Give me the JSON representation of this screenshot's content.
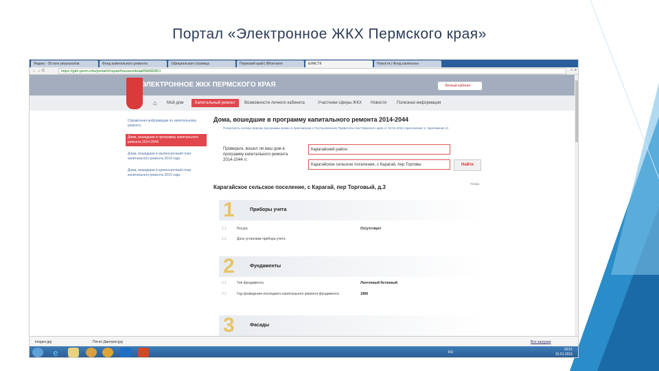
{
  "slide_title": "Портал «Электронное ЖКХ Пермского края»",
  "browser": {
    "tabs": [
      "Яндекс - 55 млн результатов",
      "Фонд капитального ремонта",
      "Официальная страница",
      "Пермский край | ВКонтакте",
      "ЕИАСТК",
      "Новости | Фонд капитальн"
    ],
    "url": "https://gkh-perm.info/portal/#/repair/houses/detail/58490851"
  },
  "header": {
    "site_title": "ЭЛЕКТРОННОЕ ЖКХ ПЕРМСКОГО КРАЯ",
    "cabinet_button": "Личный кабинет"
  },
  "nav": [
    "Мой дом",
    "Капитальный ремонт",
    "Возможности личного кабинета",
    "Участники сферы ЖКХ",
    "Новости",
    "Полезная информация"
  ],
  "sidebar": [
    "Справочная информация по капитальному ремонту",
    "Дома, вошедшие в программу капитального ремонта 2014-2044",
    "Дома, вошедшие в краткосрочный план капитального ремонта 2014 года",
    "Дома, вошедшие в краткосрочный план капитального ремонта 2015 года"
  ],
  "main": {
    "heading": "Дома, вошедшие в программу капитального ремонта 2014-2044",
    "note": "Посмотреть полную версию программы можно в приложении к Постановлению Правительства Пермского края от 02.02.2015 (приложение 1, приложение 2)",
    "question": "Проверьте, вошел ли ваш дом в программу капитального ремонта 2014-2044 гг.",
    "district": "Карагайский район",
    "address": "Карагайское сельское поселение, с Карагай, пер Торговы",
    "find_button": "Найти",
    "house_title": "Карагайское сельское поселение, с Карагай, пер Торговый, д.3",
    "back_link": "Назад",
    "sections": [
      {
        "num": "1",
        "title": "Приборы учета",
        "rows": [
          {
            "no": "1.1",
            "key": "Ресурс",
            "value": "Отсутствует"
          },
          {
            "no": "1.2",
            "key": "Дата установки прибора учета",
            "value": ""
          }
        ]
      },
      {
        "num": "2",
        "title": "Фундаменты",
        "rows": [
          {
            "no": "2.1",
            "key": "Тип фундамента",
            "value": "Ленточный бетонный"
          },
          {
            "no": "2.2",
            "key": "Год проведения последнего капитального ремонта фундамента",
            "value": "1966"
          }
        ]
      },
      {
        "num": "3",
        "title": "Фасады",
        "rows": []
      }
    ]
  },
  "downloads": [
    "images.jpg",
    "Пятно Дмитрия.jpg",
    "Все загрузки"
  ],
  "taskbar": {
    "lang": "RU",
    "time": "18:51",
    "date": "15.01.2015"
  },
  "colors": {
    "accent": "#e0464c",
    "header": "#a3adbd",
    "number": "#e8c468"
  }
}
